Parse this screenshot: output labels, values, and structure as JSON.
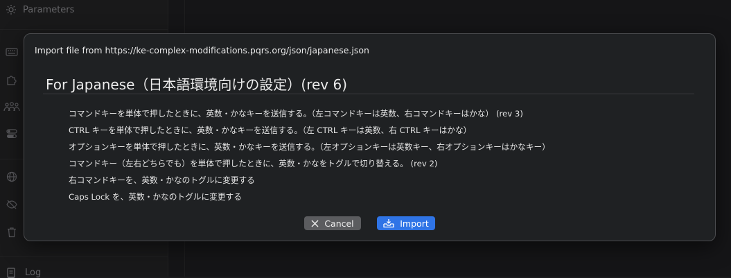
{
  "background": {
    "sidebar": {
      "parameters_label": "Parameters",
      "log_label": "Log",
      "icons": [
        "gear-icon",
        "keyboard-icon",
        "puzzle-icon",
        "devices-icon",
        "toggles-icon",
        "globe-icon",
        "no-eye-icon",
        "trash-icon",
        "document-icon"
      ]
    }
  },
  "modal": {
    "title": "Import file from https://ke-complex-modifications.pqrs.org/json/japanese.json",
    "heading": "For Japanese（日本語環境向けの設定）(rev 6)",
    "rules": [
      "コマンドキーを単体で押したときに、英数・かなキーを送信する。（左コマンドキーは英数、右コマンドキーはかな） (rev 3)",
      "CTRL キーを単体で押したときに、英数・かなキーを送信する。（左 CTRL キーは英数、右 CTRL キーはかな）",
      "オプションキーを単体で押したときに、英数・かなキーを送信する。（左オプションキーは英数キー、右オプションキーはかなキー）",
      "コマンドキー（左右どちらでも）を単体で押したときに、英数・かなをトグルで切り替える。 (rev 2)",
      "右コマンドキーを、英数・かなのトグルに変更する",
      "Caps Lock を、英数・かなのトグルに変更する"
    ],
    "buttons": {
      "cancel": "Cancel",
      "import": "Import"
    }
  },
  "colors": {
    "import_accent": "#2f74e6",
    "cancel_bg": "#5b5c5f",
    "modal_bg": "#1f2123"
  }
}
